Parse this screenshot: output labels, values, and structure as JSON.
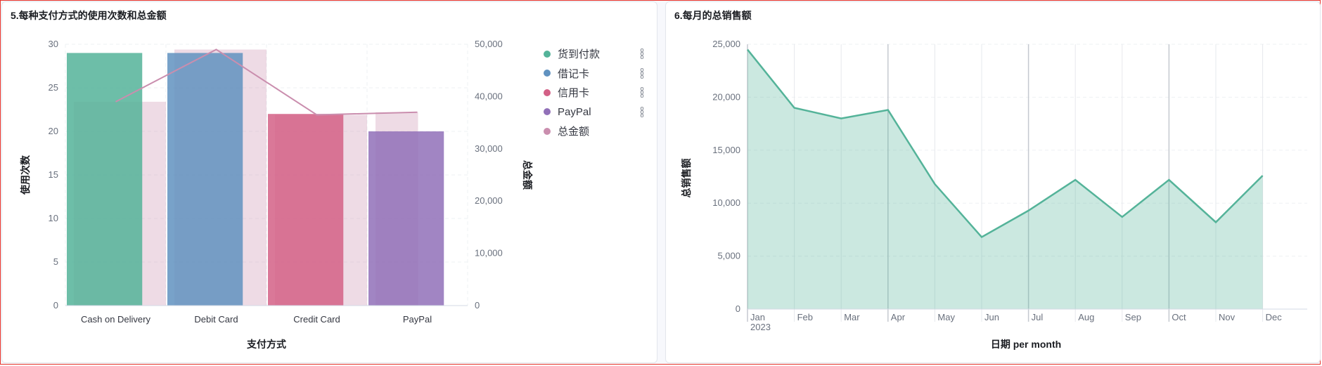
{
  "panels": {
    "left_title": "5.每种支付方式的使用次数和总金额",
    "right_title": "6.每月的总销售额"
  },
  "legend": [
    {
      "label": "货到付款",
      "color": "#54b399"
    },
    {
      "label": "借记卡",
      "color": "#6092c0"
    },
    {
      "label": "信用卡",
      "color": "#d36086"
    },
    {
      "label": "PayPal",
      "color": "#9170b8"
    },
    {
      "label": "总金额",
      "color": "#ca8eae"
    }
  ],
  "chart_data": [
    {
      "type": "bar",
      "title": "5.每种支付方式的使用次数和总金额",
      "xlabel": "支付方式",
      "ylabel": "使用次数",
      "y2label": "总金额",
      "categories": [
        "Cash on Delivery",
        "Debit Card",
        "Credit Card",
        "PayPal"
      ],
      "ylim": [
        0,
        30
      ],
      "y2lim": [
        0,
        50000
      ],
      "y_ticks": [
        "0",
        "5",
        "10",
        "15",
        "20",
        "25",
        "30"
      ],
      "y2_ticks": [
        "0",
        "10,000",
        "20,000",
        "30,000",
        "40,000",
        "50,000"
      ],
      "series": [
        {
          "name": "货到付款",
          "type": "bar",
          "axis": "left",
          "values": [
            29,
            null,
            null,
            null
          ],
          "color": "#54b399"
        },
        {
          "name": "借记卡",
          "type": "bar",
          "axis": "left",
          "values": [
            null,
            29,
            null,
            null
          ],
          "color": "#6092c0"
        },
        {
          "name": "信用卡",
          "type": "bar",
          "axis": "left",
          "values": [
            null,
            null,
            22,
            null
          ],
          "color": "#d36086"
        },
        {
          "name": "PayPal",
          "type": "bar",
          "axis": "left",
          "values": [
            null,
            null,
            null,
            20
          ],
          "color": "#9170b8"
        },
        {
          "name": "总金额",
          "type": "area",
          "axis": "right",
          "values": [
            39000,
            49000,
            36500,
            37000
          ],
          "color": "#ca8eae"
        }
      ],
      "grid": true,
      "legend_position": "right"
    },
    {
      "type": "area",
      "title": "6.每月的总销售额",
      "xlabel": "日期 per month",
      "ylabel": "总销售额",
      "x": [
        "Jan",
        "Feb",
        "Mar",
        "Apr",
        "May",
        "Jun",
        "Jul",
        "Aug",
        "Sep",
        "Oct",
        "Nov",
        "Dec"
      ],
      "x_year_label": "2023",
      "y_ticks": [
        "0",
        "5,000",
        "10,000",
        "15,000",
        "20,000",
        "25,000"
      ],
      "ylim": [
        0,
        25000
      ],
      "series": [
        {
          "values": [
            24500,
            19000,
            18000,
            18800,
            11800,
            6800,
            9300,
            12200,
            8700,
            12200,
            8200,
            12600
          ],
          "color": "#54b399"
        }
      ],
      "grid": true
    }
  ]
}
